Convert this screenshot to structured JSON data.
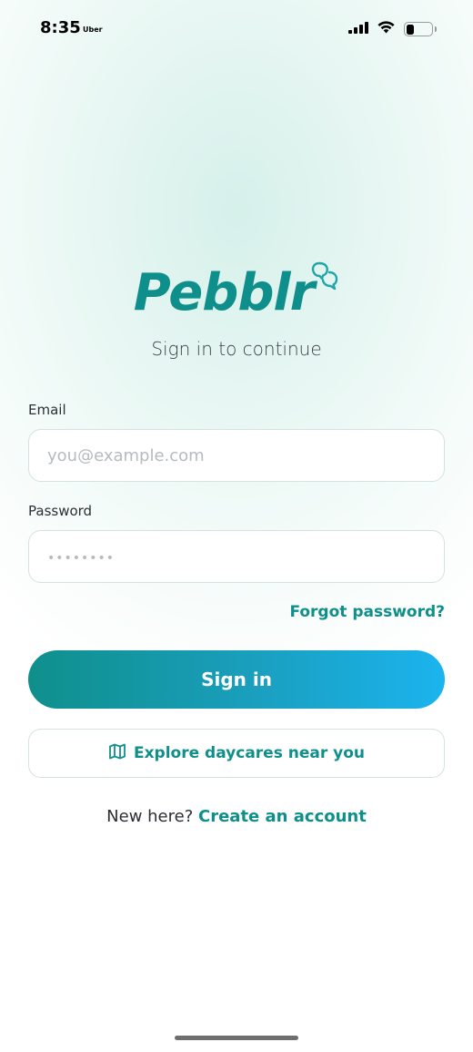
{
  "status_bar": {
    "time": "8:35",
    "carrier_label": "Uber",
    "battery_level": 0.3,
    "icons": [
      "signal-icon",
      "wifi-icon",
      "battery-icon"
    ]
  },
  "brand": {
    "name": "Pebblr",
    "logo_icon": "chat-bubbles-icon",
    "color": "#0f8f8b"
  },
  "subtitle": "Sign in to continue",
  "form": {
    "email_label": "Email",
    "email_placeholder": "you@example.com",
    "password_label": "Password",
    "password_placeholder": "••••••••",
    "forgot_label": "Forgot password?",
    "signin_label": "Sign in"
  },
  "explore": {
    "icon": "map-icon",
    "label": "Explore daycares near you"
  },
  "signup": {
    "prompt": "New here?",
    "link_label": "Create an account"
  },
  "colors": {
    "accent": "#0f8f8b",
    "gradient_end": "#1bb4ee"
  }
}
